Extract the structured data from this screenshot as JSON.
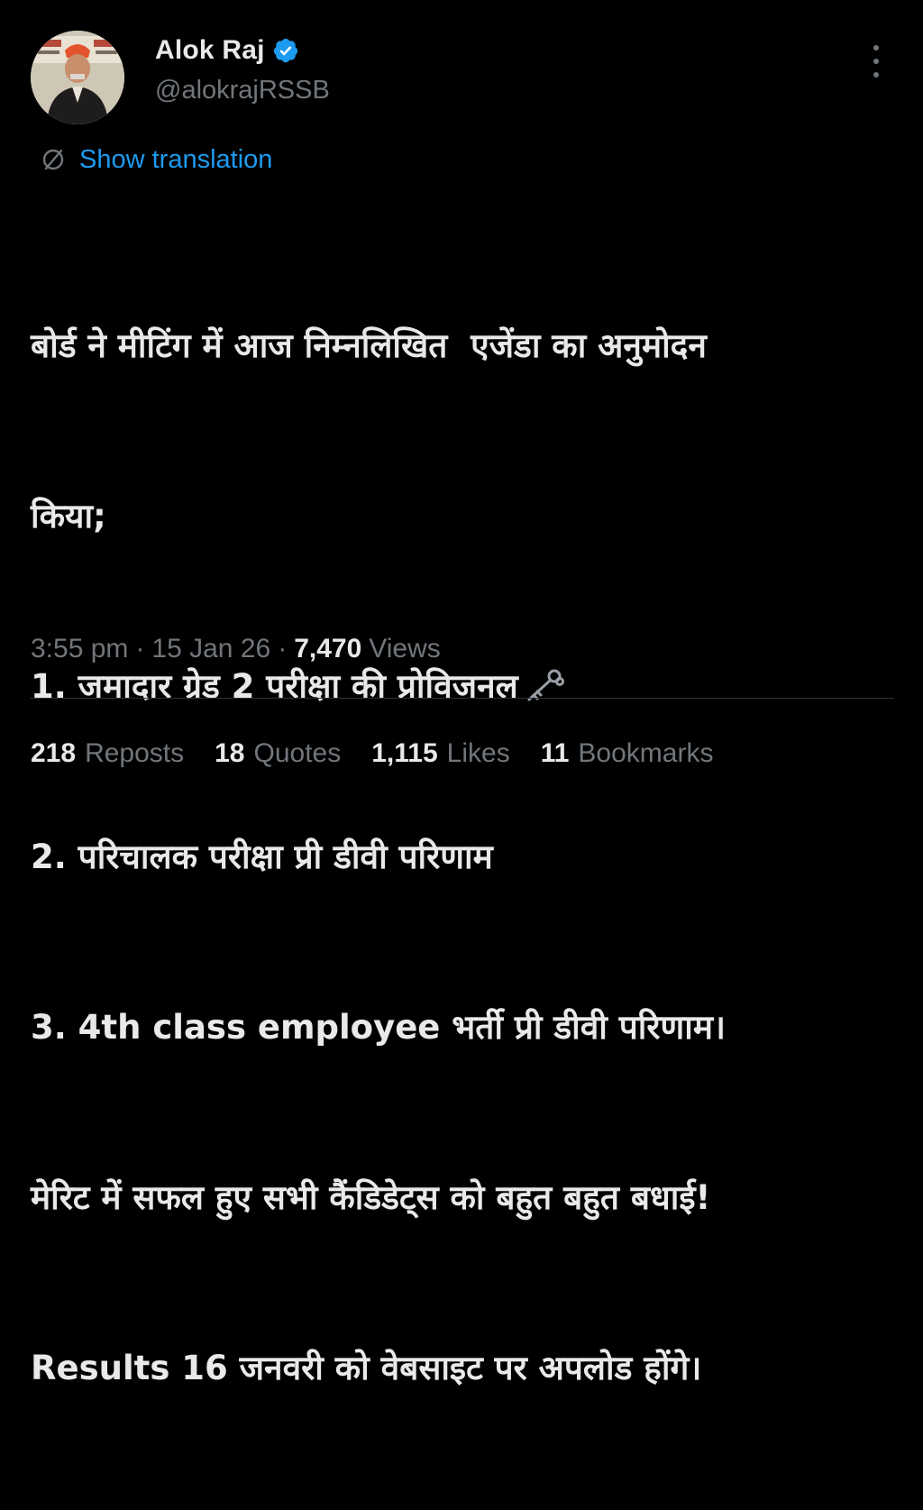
{
  "author": {
    "display_name": "Alok Raj",
    "handle": "@alokrajRSSB",
    "verified": true,
    "avatar_icon": "profile-photo"
  },
  "translate": {
    "label": "Show translation",
    "icon": "globe-slash-icon"
  },
  "tweet": {
    "lines": [
      "बोर्ड ने मीटिंग में आज निम्नलिखित  एजेंडा का अनुमोदन",
      "किया;",
      "1. जमादार ग्रेड 2 परीक्षा की प्रोविजनल",
      "2. परिचालक परीक्षा प्री डीवी परिणाम",
      "3. 4th class employee भर्ती प्री डीवी परिणाम।",
      "मेरिट में सफल हुए सभी कैंडिडेट्स को बहुत बहुत बधाई!",
      "Results 16 जनवरी को वेबसाइट पर अपलोड होंगे।"
    ],
    "emoji": "old-key-icon"
  },
  "meta": {
    "time": "3:55 pm",
    "separator": "·",
    "date": "15 Jan 26",
    "views_count": "7,470",
    "views_label": "Views"
  },
  "stats": {
    "reposts_count": "218",
    "reposts_label": "Reposts",
    "quotes_count": "18",
    "quotes_label": "Quotes",
    "likes_count": "1,115",
    "likes_label": "Likes",
    "bookmarks_count": "11",
    "bookmarks_label": "Bookmarks"
  },
  "colors": {
    "background": "#000000",
    "text": "#e7e9ea",
    "secondary": "#71767b",
    "accent": "#1d9bf0",
    "divider": "#2f3336"
  }
}
